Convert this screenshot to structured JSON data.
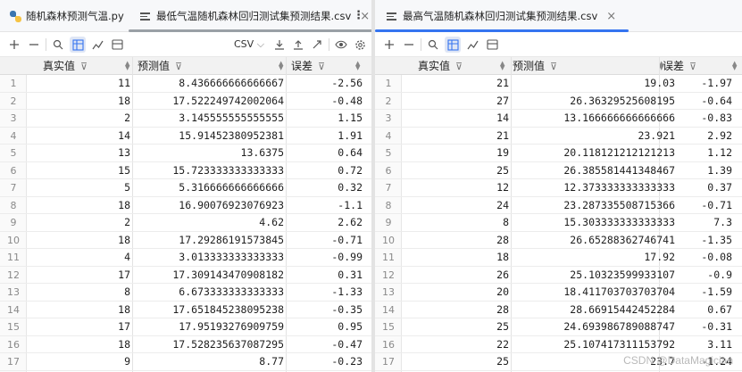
{
  "left": {
    "tabs": [
      {
        "label": "随机森林预测气温.py",
        "icon": "python-file-icon"
      },
      {
        "label": "最低气温随机森林回归测试集预测结果.csv",
        "icon": "csv-file-icon",
        "close": "×"
      }
    ],
    "toolbar": {
      "format": "CSV",
      "format_arrow": "⌵"
    },
    "columns": [
      "真实值",
      "预测值",
      "误差"
    ],
    "rows": [
      [
        "1",
        "11",
        "8.436666666666667",
        "-2.56"
      ],
      [
        "2",
        "18",
        "17.522249742002064",
        "-0.48"
      ],
      [
        "3",
        "2",
        "3.145555555555555",
        "1.15"
      ],
      [
        "4",
        "14",
        "15.91452380952381",
        "1.91"
      ],
      [
        "5",
        "13",
        "13.6375",
        "0.64"
      ],
      [
        "6",
        "15",
        "15.723333333333333",
        "0.72"
      ],
      [
        "7",
        "5",
        "5.316666666666666",
        "0.32"
      ],
      [
        "8",
        "18",
        "16.90076923076923",
        "-1.1"
      ],
      [
        "9",
        "2",
        "4.62",
        "2.62"
      ],
      [
        "10",
        "18",
        "17.29286191573845",
        "-0.71"
      ],
      [
        "11",
        "4",
        "3.013333333333333",
        "-0.99"
      ],
      [
        "12",
        "17",
        "17.309143470908182",
        "0.31"
      ],
      [
        "13",
        "8",
        "6.673333333333333",
        "-1.33"
      ],
      [
        "14",
        "18",
        "17.651845238095238",
        "-0.35"
      ],
      [
        "15",
        "17",
        "17.95193276909759",
        "0.95"
      ],
      [
        "16",
        "18",
        "17.528235637087295",
        "-0.47"
      ],
      [
        "17",
        "9",
        "8.77",
        "-0.23"
      ]
    ]
  },
  "right": {
    "tabs": [
      {
        "label": "最高气温随机森林回归测试集预测结果.csv",
        "icon": "csv-file-icon",
        "close": "×"
      }
    ],
    "columns": [
      "真实值",
      "预测值",
      "误差"
    ],
    "rows": [
      [
        "1",
        "21",
        "19.03",
        "-1.97"
      ],
      [
        "2",
        "27",
        "26.36329525608195",
        "-0.64"
      ],
      [
        "3",
        "14",
        "13.166666666666666",
        "-0.83"
      ],
      [
        "4",
        "21",
        "23.921",
        "2.92"
      ],
      [
        "5",
        "19",
        "20.118121212121213",
        "1.12"
      ],
      [
        "6",
        "25",
        "26.385581441348467",
        "1.39"
      ],
      [
        "7",
        "12",
        "12.373333333333333",
        "0.37"
      ],
      [
        "8",
        "24",
        "23.287335508715366",
        "-0.71"
      ],
      [
        "9",
        "8",
        "15.303333333333333",
        "7.3"
      ],
      [
        "10",
        "28",
        "26.65288362746741",
        "-1.35"
      ],
      [
        "11",
        "18",
        "17.92",
        "-0.08"
      ],
      [
        "12",
        "26",
        "25.10323599933107",
        "-0.9"
      ],
      [
        "13",
        "20",
        "18.411703703703704",
        "-1.59"
      ],
      [
        "14",
        "28",
        "28.66915442452284",
        "0.67"
      ],
      [
        "15",
        "25",
        "24.693986789088747",
        "-0.31"
      ],
      [
        "16",
        "22",
        "25.107417311153792",
        "3.11"
      ],
      [
        "17",
        "25",
        "23.7",
        "-1.24"
      ]
    ],
    "watermark": "CSDN @DataMagician"
  },
  "more_label": "⋮"
}
